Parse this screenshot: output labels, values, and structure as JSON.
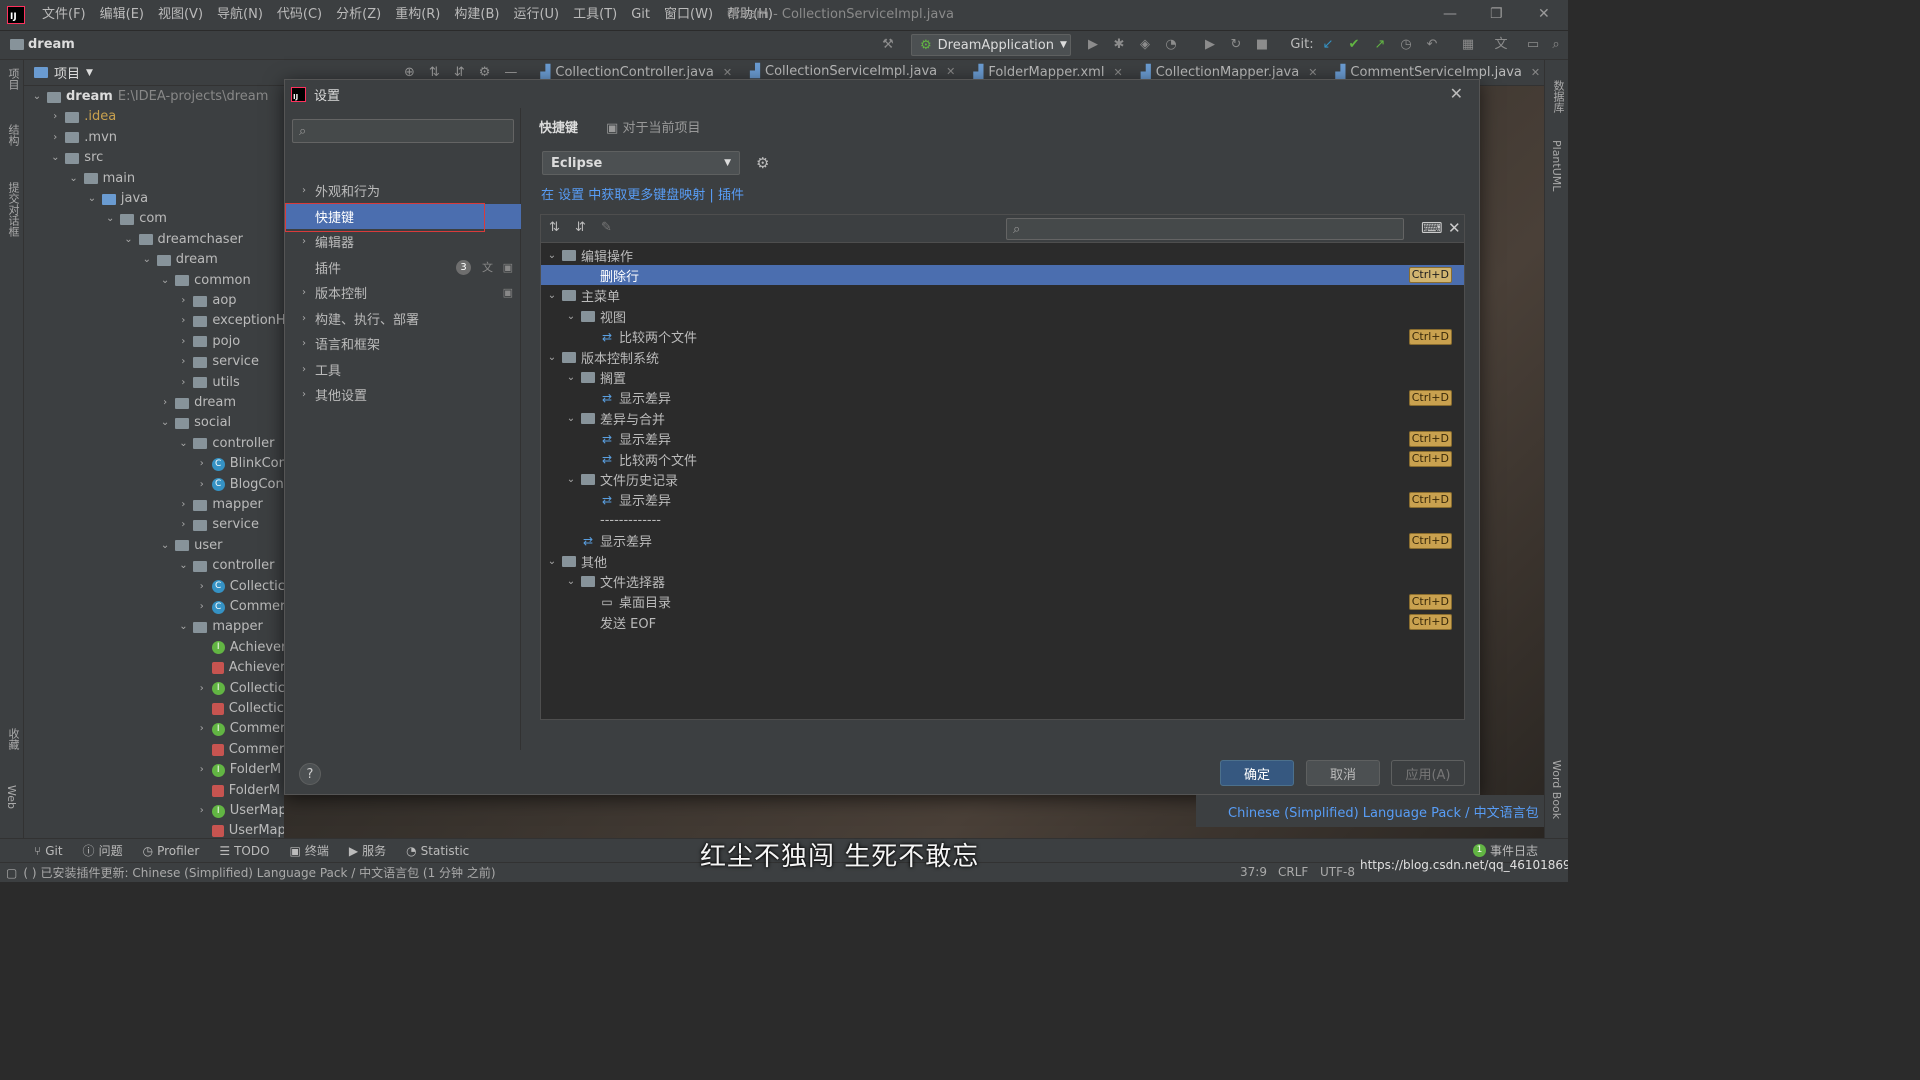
{
  "menubar": {
    "items": [
      "文件(F)",
      "编辑(E)",
      "视图(V)",
      "导航(N)",
      "代码(C)",
      "分析(Z)",
      "重构(R)",
      "构建(B)",
      "运行(U)",
      "工具(T)",
      "Git",
      "窗口(W)",
      "帮助(H)"
    ],
    "window_title": "dream - CollectionServiceImpl.java"
  },
  "toolbar": {
    "project_name": "dream",
    "run_config": "DreamApplication",
    "git_label": "Git:"
  },
  "left_strip": {
    "labels": [
      "项目",
      "结构",
      "提交对话框",
      "收藏",
      "Web"
    ]
  },
  "project_panel": {
    "header": "项目",
    "rows": [
      {
        "label": "dream",
        "extra": "E:\\IDEA-projects\\dream",
        "depth": 0,
        "icon": "folder-icon",
        "chev": "open",
        "bold": true
      },
      {
        "label": ".idea",
        "depth": 1,
        "icon": "folder-icon",
        "chev": "closed",
        "color": "#c9a14f"
      },
      {
        "label": ".mvn",
        "depth": 1,
        "icon": "folder-icon",
        "chev": "closed"
      },
      {
        "label": "src",
        "depth": 1,
        "icon": "folder-icon",
        "chev": "open"
      },
      {
        "label": "main",
        "depth": 2,
        "icon": "folder-icon",
        "chev": "open"
      },
      {
        "label": "java",
        "depth": 3,
        "icon": "folder-blue-icon",
        "chev": "open"
      },
      {
        "label": "com",
        "depth": 4,
        "icon": "package-icon",
        "chev": "open"
      },
      {
        "label": "dreamchaser",
        "depth": 5,
        "icon": "package-icon",
        "chev": "open"
      },
      {
        "label": "dream",
        "depth": 6,
        "icon": "package-icon",
        "chev": "open"
      },
      {
        "label": "common",
        "depth": 7,
        "icon": "package-icon",
        "chev": "open"
      },
      {
        "label": "aop",
        "depth": 8,
        "icon": "package-icon",
        "chev": "closed"
      },
      {
        "label": "exceptionH",
        "depth": 8,
        "icon": "package-icon",
        "chev": "closed"
      },
      {
        "label": "pojo",
        "depth": 8,
        "icon": "package-icon",
        "chev": "closed"
      },
      {
        "label": "service",
        "depth": 8,
        "icon": "package-icon",
        "chev": "closed"
      },
      {
        "label": "utils",
        "depth": 8,
        "icon": "package-icon",
        "chev": "closed"
      },
      {
        "label": "dream",
        "depth": 7,
        "icon": "package-icon",
        "chev": "closed"
      },
      {
        "label": "social",
        "depth": 7,
        "icon": "package-icon",
        "chev": "open"
      },
      {
        "label": "controller",
        "depth": 8,
        "icon": "package-icon",
        "chev": "open"
      },
      {
        "label": "BlinkCon",
        "depth": 9,
        "icon": "class-icon",
        "chev": "closed"
      },
      {
        "label": "BlogCon",
        "depth": 9,
        "icon": "class-icon",
        "chev": "closed"
      },
      {
        "label": "mapper",
        "depth": 8,
        "icon": "package-icon",
        "chev": "closed"
      },
      {
        "label": "service",
        "depth": 8,
        "icon": "package-icon",
        "chev": "closed"
      },
      {
        "label": "user",
        "depth": 7,
        "icon": "package-icon",
        "chev": "open"
      },
      {
        "label": "controller",
        "depth": 8,
        "icon": "package-icon",
        "chev": "open"
      },
      {
        "label": "Collectic",
        "depth": 9,
        "icon": "class-icon",
        "chev": "closed"
      },
      {
        "label": "Commer",
        "depth": 9,
        "icon": "class-icon",
        "chev": "closed"
      },
      {
        "label": "mapper",
        "depth": 8,
        "icon": "package-icon",
        "chev": "open"
      },
      {
        "label": "Achiever",
        "depth": 9,
        "icon": "interface-icon",
        "chev": "none"
      },
      {
        "label": "Achiever",
        "depth": 9,
        "icon": "xml-icon",
        "chev": "none"
      },
      {
        "label": "Collectic",
        "depth": 9,
        "icon": "interface-icon",
        "chev": "closed"
      },
      {
        "label": "Collectic",
        "depth": 9,
        "icon": "xml-icon",
        "chev": "none"
      },
      {
        "label": "Commer",
        "depth": 9,
        "icon": "interface-icon",
        "chev": "closed"
      },
      {
        "label": "Commer",
        "depth": 9,
        "icon": "xml-icon",
        "chev": "none"
      },
      {
        "label": "FolderM",
        "depth": 9,
        "icon": "interface-icon",
        "chev": "closed"
      },
      {
        "label": "FolderM",
        "depth": 9,
        "icon": "xml-icon",
        "chev": "none"
      },
      {
        "label": "UserMapper",
        "depth": 9,
        "icon": "interface-icon",
        "chev": "closed"
      },
      {
        "label": "UserMapper.xml",
        "depth": 9,
        "icon": "xml-icon",
        "chev": "none"
      }
    ]
  },
  "editor_tabs": [
    {
      "label": "CollectionController.java",
      "active": false
    },
    {
      "label": "CollectionServiceImpl.java",
      "active": true
    },
    {
      "label": "FolderMapper.xml",
      "active": false
    },
    {
      "label": "CollectionMapper.java",
      "active": false
    },
    {
      "label": "CommentServiceImpl.java",
      "active": false
    }
  ],
  "dialog": {
    "title": "设置",
    "sidebar": [
      {
        "label": "外观和行为",
        "chev": true,
        "selected": false
      },
      {
        "label": "快捷键",
        "chev": false,
        "selected": true
      },
      {
        "label": "编辑器",
        "chev": true,
        "selected": false
      },
      {
        "label": "插件",
        "chev": false,
        "selected": false,
        "badge": "3"
      },
      {
        "label": "版本控制",
        "chev": true,
        "selected": false
      },
      {
        "label": "构建、执行、部署",
        "chev": true,
        "selected": false
      },
      {
        "label": "语言和框架",
        "chev": true,
        "selected": false
      },
      {
        "label": "工具",
        "chev": true,
        "selected": false
      },
      {
        "label": "其他设置",
        "chev": true,
        "selected": false
      }
    ],
    "main": {
      "title": "快捷键",
      "scope": "对于当前项目",
      "keymap": "Eclipse",
      "link_prefix": "在 设置 中获取更多键盘映射",
      "link_sep": "|",
      "link_plugins": "插件"
    },
    "tree": [
      {
        "label": "编辑操作",
        "depth": 0,
        "chev": "open",
        "icon": "folder-icon",
        "shortcut": ""
      },
      {
        "label": "删除行",
        "depth": 2,
        "chev": "none",
        "icon": "",
        "shortcut": "Ctrl+D",
        "selected": true
      },
      {
        "label": "主菜单",
        "depth": 0,
        "chev": "open",
        "icon": "folder-icon",
        "shortcut": ""
      },
      {
        "label": "视图",
        "depth": 1,
        "chev": "open",
        "icon": "folder-icon",
        "shortcut": ""
      },
      {
        "label": "比较两个文件",
        "depth": 2,
        "chev": "none",
        "icon": "action-icon",
        "shortcut": "Ctrl+D"
      },
      {
        "label": "版本控制系统",
        "depth": 0,
        "chev": "open",
        "icon": "folder-icon",
        "shortcut": ""
      },
      {
        "label": "搁置",
        "depth": 1,
        "chev": "open",
        "icon": "folder-icon",
        "shortcut": ""
      },
      {
        "label": "显示差异",
        "depth": 2,
        "chev": "none",
        "icon": "action-icon",
        "shortcut": "Ctrl+D"
      },
      {
        "label": "差异与合并",
        "depth": 1,
        "chev": "open",
        "icon": "folder-icon",
        "shortcut": ""
      },
      {
        "label": "显示差异",
        "depth": 2,
        "chev": "none",
        "icon": "action-icon",
        "shortcut": "Ctrl+D"
      },
      {
        "label": "比较两个文件",
        "depth": 2,
        "chev": "none",
        "icon": "action-icon",
        "shortcut": "Ctrl+D"
      },
      {
        "label": "文件历史记录",
        "depth": 1,
        "chev": "open",
        "icon": "folder-icon",
        "shortcut": ""
      },
      {
        "label": "显示差异",
        "depth": 2,
        "chev": "none",
        "icon": "action-icon",
        "shortcut": "Ctrl+D"
      },
      {
        "label": "-------------",
        "depth": 2,
        "chev": "none",
        "icon": "",
        "shortcut": ""
      },
      {
        "label": "显示差异",
        "depth": 1,
        "chev": "none",
        "icon": "action-icon",
        "shortcut": "Ctrl+D"
      },
      {
        "label": "其他",
        "depth": 0,
        "chev": "open",
        "icon": "folder-icon",
        "shortcut": ""
      },
      {
        "label": "文件选择器",
        "depth": 1,
        "chev": "open",
        "icon": "folder-icon",
        "shortcut": ""
      },
      {
        "label": "桌面目录",
        "depth": 2,
        "chev": "none",
        "icon": "monitor-icon",
        "shortcut": "Ctrl+D"
      },
      {
        "label": "发送 EOF",
        "depth": 2,
        "chev": "none",
        "icon": "",
        "shortcut": "Ctrl+D"
      }
    ],
    "buttons": {
      "ok": "确定",
      "cancel": "取消",
      "apply": "应用(A)",
      "help": "?"
    }
  },
  "notification": "Chinese (Simplified) Language Pack / 中文语言包",
  "bottom_tabs": [
    "Git",
    "问题",
    "Profiler",
    "TODO",
    "终端",
    "服务",
    "Statistic"
  ],
  "event_log": "事件日志",
  "event_count": "1",
  "status": {
    "message": "已安装插件更新: Chinese (Simplified) Language Pack / 中文语言包 (1 分钟 之前)",
    "position": "37:9",
    "line_sep": "CRLF",
    "encoding": "UTF-8"
  },
  "subtitle": "红尘不独闯 生死不敢忘",
  "watermark": "https://blog.csdn.net/qq_46101869",
  "right_strip": [
    "数据库",
    "PlantUML",
    "Word Book"
  ],
  "colors": {
    "accent": "#4b6eaf",
    "shortcut_bg": "#c9a14f",
    "link": "#589df6",
    "selection_border": "#d93b3b"
  }
}
